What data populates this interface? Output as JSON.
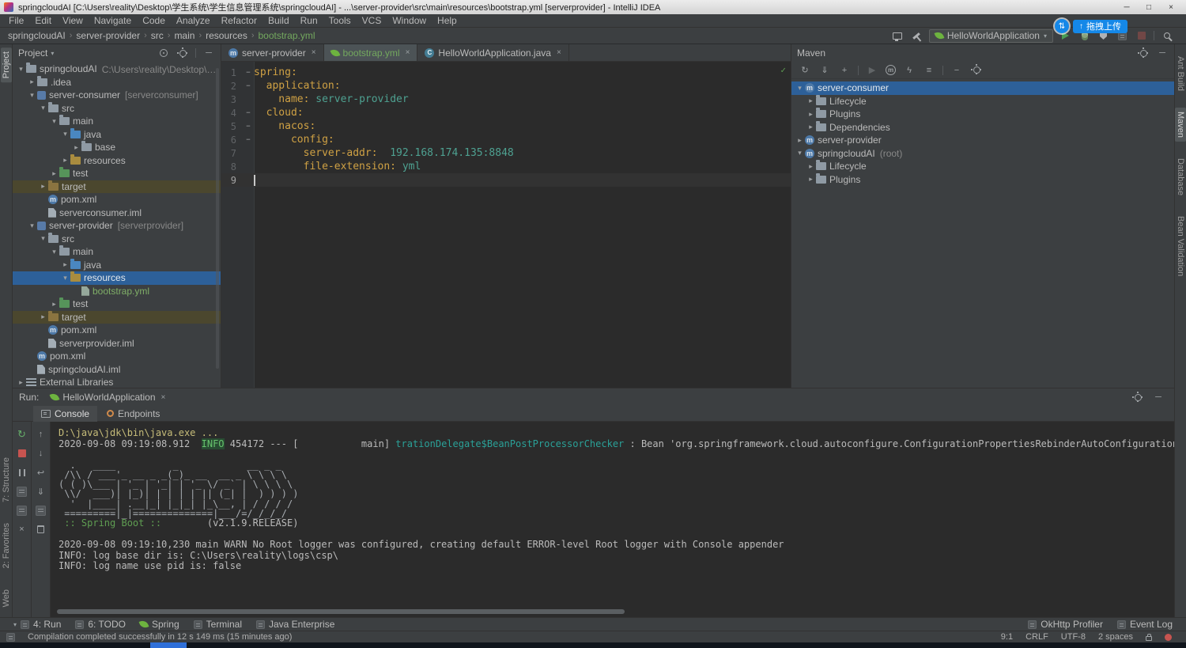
{
  "window": {
    "title": "springcloudAI [C:\\Users\\reality\\Desktop\\学生系统\\学生信息管理系统\\springcloudAI] - ...\\server-provider\\src\\main\\resources\\bootstrap.yml [serverprovider] - IntelliJ IDEA"
  },
  "menu": [
    "File",
    "Edit",
    "View",
    "Navigate",
    "Code",
    "Analyze",
    "Refactor",
    "Build",
    "Run",
    "Tools",
    "VCS",
    "Window",
    "Help"
  ],
  "navbar": {
    "crumbs": [
      "springcloudAI",
      "server-provider",
      "src",
      "main",
      "resources",
      "bootstrap.yml"
    ],
    "run_config": "HelloWorldApplication",
    "overlay_button": "拖拽上传"
  },
  "left_stripe": {
    "top": [
      "Project"
    ],
    "bottom": [
      "7: Structure",
      "2: Favorites",
      "Web"
    ]
  },
  "right_stripe": [
    "Ant Build",
    "Maven",
    "Database",
    "Bean Validation"
  ],
  "project": {
    "header": "Project",
    "tree": [
      {
        "indent": 0,
        "arrow": "down",
        "icon": "project",
        "label": "springcloudAI",
        "extra": "C:\\Users\\reality\\Desktop\\学生系统\\学生信息管理系统\\springcloudAI"
      },
      {
        "indent": 1,
        "arrow": "right",
        "icon": "folder",
        "label": ".idea"
      },
      {
        "indent": 1,
        "arrow": "down",
        "icon": "module",
        "label": "server-consumer",
        "extra": "[serverconsumer]"
      },
      {
        "indent": 2,
        "arrow": "down",
        "icon": "folder",
        "label": "src"
      },
      {
        "indent": 3,
        "arrow": "down",
        "icon": "folder",
        "label": "main"
      },
      {
        "indent": 4,
        "arrow": "down",
        "icon": "source",
        "label": "java"
      },
      {
        "indent": 5,
        "arrow": "right",
        "icon": "package",
        "label": "base"
      },
      {
        "indent": 4,
        "arrow": "right",
        "icon": "resources",
        "label": "resources"
      },
      {
        "indent": 3,
        "arrow": "right",
        "icon": "test",
        "label": "test"
      },
      {
        "indent": 2,
        "arrow": "right",
        "icon": "excluded",
        "label": "target",
        "row": "excluded"
      },
      {
        "indent": 2,
        "arrow": "none",
        "icon": "maven",
        "label": "pom.xml"
      },
      {
        "indent": 2,
        "arrow": "none",
        "icon": "iml",
        "label": "serverconsumer.iml"
      },
      {
        "indent": 1,
        "arrow": "down",
        "icon": "module",
        "label": "server-provider",
        "extra": "[serverprovider]"
      },
      {
        "indent": 2,
        "arrow": "down",
        "icon": "folder",
        "label": "src"
      },
      {
        "indent": 3,
        "arrow": "down",
        "icon": "folder",
        "label": "main"
      },
      {
        "indent": 4,
        "arrow": "right",
        "icon": "source",
        "label": "java"
      },
      {
        "indent": 4,
        "arrow": "down",
        "icon": "resources",
        "label": "resources",
        "selected": true
      },
      {
        "indent": 5,
        "arrow": "none",
        "icon": "yaml",
        "label": "bootstrap.yml",
        "color": "added"
      },
      {
        "indent": 3,
        "arrow": "right",
        "icon": "test",
        "label": "test"
      },
      {
        "indent": 2,
        "arrow": "right",
        "icon": "excluded",
        "label": "target",
        "row": "excluded"
      },
      {
        "indent": 2,
        "arrow": "none",
        "icon": "maven",
        "label": "pom.xml"
      },
      {
        "indent": 2,
        "arrow": "none",
        "icon": "iml",
        "label": "serverprovider.iml"
      },
      {
        "indent": 1,
        "arrow": "none",
        "icon": "maven",
        "label": "pom.xml"
      },
      {
        "indent": 1,
        "arrow": "none",
        "icon": "iml",
        "label": "springcloudAI.iml"
      },
      {
        "indent": 0,
        "arrow": "right",
        "icon": "libraries",
        "label": "External Libraries"
      }
    ]
  },
  "editor": {
    "tabs": [
      {
        "label": "server-provider",
        "icon": "maven"
      },
      {
        "label": "bootstrap.yml",
        "icon": "spring",
        "active": true,
        "color": "added"
      },
      {
        "label": "HelloWorldApplication.java",
        "icon": "class"
      }
    ],
    "lines": [
      {
        "num": 1,
        "fold": true,
        "tokens": [
          {
            "c": "key",
            "t": "spring:"
          }
        ]
      },
      {
        "num": 2,
        "fold": true,
        "tokens": [
          {
            "c": "key",
            "t": "  application:"
          }
        ]
      },
      {
        "num": 3,
        "tokens": [
          {
            "c": "key",
            "t": "    name:"
          },
          {
            "c": "val",
            "t": " server-provider"
          }
        ]
      },
      {
        "num": 4,
        "fold": true,
        "tokens": [
          {
            "c": "key",
            "t": "  cloud:"
          }
        ]
      },
      {
        "num": 5,
        "fold": true,
        "tokens": [
          {
            "c": "key",
            "t": "    nacos:"
          }
        ]
      },
      {
        "num": 6,
        "fold": true,
        "tokens": [
          {
            "c": "key",
            "t": "      config:"
          }
        ]
      },
      {
        "num": 7,
        "tokens": [
          {
            "c": "key",
            "t": "        server-addr:"
          },
          {
            "c": "val",
            "t": "  192.168.174.135:8848"
          }
        ]
      },
      {
        "num": 8,
        "tokens": [
          {
            "c": "key",
            "t": "        file-extension:"
          },
          {
            "c": "val",
            "t": " yml"
          }
        ]
      },
      {
        "num": 9,
        "caret": true,
        "tokens": []
      }
    ]
  },
  "maven": {
    "header": "Maven",
    "tree": [
      {
        "indent": 0,
        "arrow": "down",
        "icon": "maven",
        "label": "server-consumer",
        "selected": true
      },
      {
        "indent": 1,
        "arrow": "right",
        "icon": "lifecycle",
        "label": "Lifecycle"
      },
      {
        "indent": 1,
        "arrow": "right",
        "icon": "plugins",
        "label": "Plugins"
      },
      {
        "indent": 1,
        "arrow": "right",
        "icon": "dependencies",
        "label": "Dependencies"
      },
      {
        "indent": 0,
        "arrow": "right",
        "icon": "maven",
        "label": "server-provider"
      },
      {
        "indent": 0,
        "arrow": "down",
        "icon": "maven",
        "label": "springcloudAI",
        "extra": "(root)"
      },
      {
        "indent": 1,
        "arrow": "right",
        "icon": "lifecycle",
        "label": "Lifecycle"
      },
      {
        "indent": 1,
        "arrow": "right",
        "icon": "plugins",
        "label": "Plugins"
      }
    ]
  },
  "run": {
    "label": "Run:",
    "tab": "HelloWorldApplication",
    "tabs": [
      "Console",
      "Endpoints"
    ],
    "console": {
      "lines": [
        {
          "parts": [
            {
              "c": "cmd",
              "t": "D:\\java\\jdk\\bin\\java.exe ..."
            }
          ]
        },
        {
          "parts": [
            {
              "c": "def",
              "t": "2020-09-08 09:19:08.912  "
            },
            {
              "c": "info",
              "t": "INFO"
            },
            {
              "c": "def",
              "t": " 454172 --- [           main] "
            },
            {
              "c": "cyan",
              "t": "trationDelegate$BeanPostProcessorChecker"
            },
            {
              "c": "def",
              "t": " : Bean 'org.springframework.cloud.autoconfigure.ConfigurationPropertiesRebinderAutoConfiguration' of type [org.springframework"
            }
          ]
        },
        {
          "blank": true
        },
        {
          "pre": "  .   ____          _            __ _ _\n /\\\\ / ___'_ __ _ _(_)_ __  __ _ \\ \\ \\ \\\n( ( )\\___ | '_ | '_| | '_ \\/ _` | \\ \\ \\ \\\n \\\\/  ___)| |_)| | | | | || (_| |  ) ) ) )\n  '  |____| .__|_| |_|_| |_\\__, | / / / /\n =========|_|==============|___/=/_/_/_/"
        },
        {
          "parts": [
            {
              "c": "green",
              "t": " :: Spring Boot ::"
            },
            {
              "c": "def",
              "t": "        (v2.1.9.RELEASE)"
            }
          ]
        },
        {
          "blank": true
        },
        {
          "parts": [
            {
              "c": "def",
              "t": "2020-09-08 09:19:10,230 main WARN No Root logger was configured, creating default ERROR-level Root logger with Console appender"
            }
          ]
        },
        {
          "parts": [
            {
              "c": "def",
              "t": "INFO: log base dir is: C:\\Users\\reality\\logs\\csp\\"
            }
          ]
        },
        {
          "parts": [
            {
              "c": "def",
              "t": "INFO: log name use pid is: false"
            }
          ]
        }
      ]
    }
  },
  "bottom_bar": {
    "left": [
      "4: Run",
      "6: TODO",
      "Spring",
      "Terminal",
      "Java Enterprise"
    ],
    "right": [
      "OkHttp Profiler",
      "Event Log"
    ]
  },
  "status_bar": {
    "message": "Compilation completed successfully in 12 s 149 ms (15 minutes ago)",
    "position": "9:1",
    "line_sep": "CRLF",
    "encoding": "UTF-8",
    "indent": "2 spaces"
  },
  "colors": {
    "panel_bg": "#3c3f41",
    "editor_bg": "#2b2b2b",
    "selection_blue": "#2d6099",
    "excluded_row_olive": "#4b472e",
    "added_file_green": "#7fae67",
    "yaml_key_orange": "#cfa144",
    "yaml_value_teal": "#4ea191",
    "run_green": "#499c54",
    "stop_red": "#c75450",
    "overlay_blue": "#1588e8",
    "logger_cyan": "#2aa198",
    "info_green": "#67c46d"
  }
}
